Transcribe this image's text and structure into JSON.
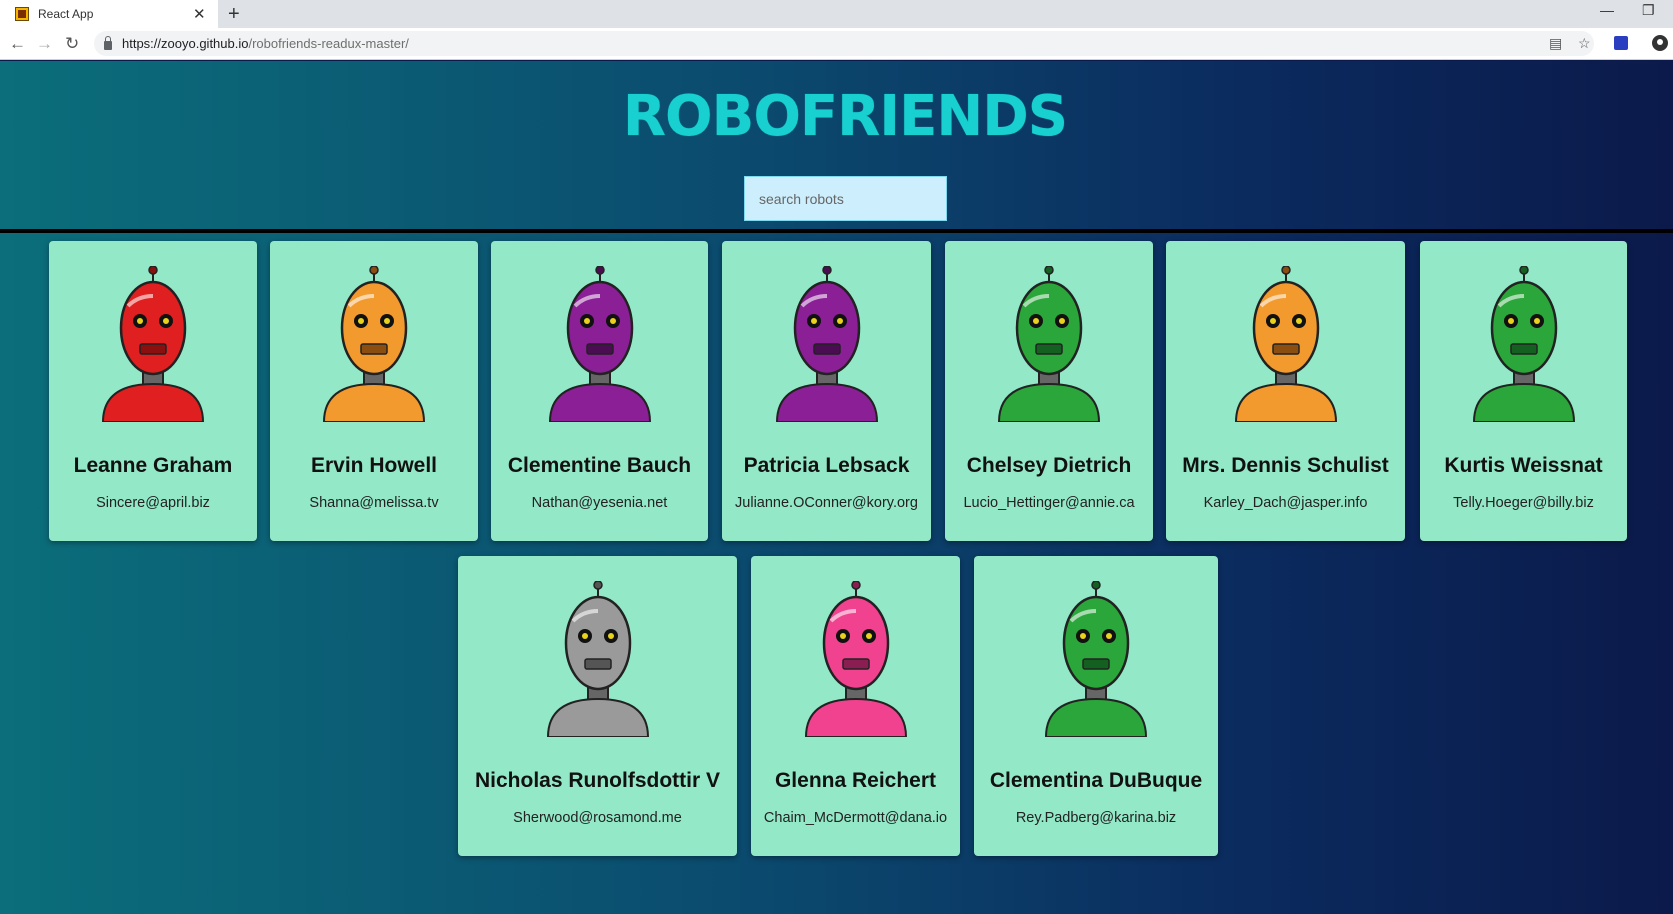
{
  "browser": {
    "tab_title": "React App",
    "url_host": "https://zooyo.github.io",
    "url_path": "/robofriends-readux-master/"
  },
  "page": {
    "logo": "ROBOFRIENDS",
    "search_placeholder": "search robots"
  },
  "robots": [
    {
      "name": "Leanne Graham",
      "email": "Sincere@april.biz",
      "color": "#e02020",
      "dark": "#8a0f0f"
    },
    {
      "name": "Ervin Howell",
      "email": "Shanna@melissa.tv",
      "color": "#f39a2e",
      "dark": "#8a4e10"
    },
    {
      "name": "Clementine Bauch",
      "email": "Nathan@yesenia.net",
      "color": "#8a1f96",
      "dark": "#4a0d52"
    },
    {
      "name": "Patricia Lebsack",
      "email": "Julianne.OConner@kory.org",
      "color": "#8a1f96",
      "dark": "#4a0d52"
    },
    {
      "name": "Chelsey Dietrich",
      "email": "Lucio_Hettinger@annie.ca",
      "color": "#2aa63a",
      "dark": "#136020"
    },
    {
      "name": "Mrs. Dennis Schulist",
      "email": "Karley_Dach@jasper.info",
      "color": "#f39a2e",
      "dark": "#8a4e10"
    },
    {
      "name": "Kurtis Weissnat",
      "email": "Telly.Hoeger@billy.biz",
      "color": "#2aa63a",
      "dark": "#136020"
    },
    {
      "name": "Nicholas Runolfsdottir V",
      "email": "Sherwood@rosamond.me",
      "color": "#9a9a9a",
      "dark": "#555555"
    },
    {
      "name": "Glenna Reichert",
      "email": "Chaim_McDermott@dana.io",
      "color": "#f0428e",
      "dark": "#8a1e52"
    },
    {
      "name": "Clementina DuBuque",
      "email": "Rey.Padberg@karina.biz",
      "color": "#2aa63a",
      "dark": "#136020"
    }
  ]
}
